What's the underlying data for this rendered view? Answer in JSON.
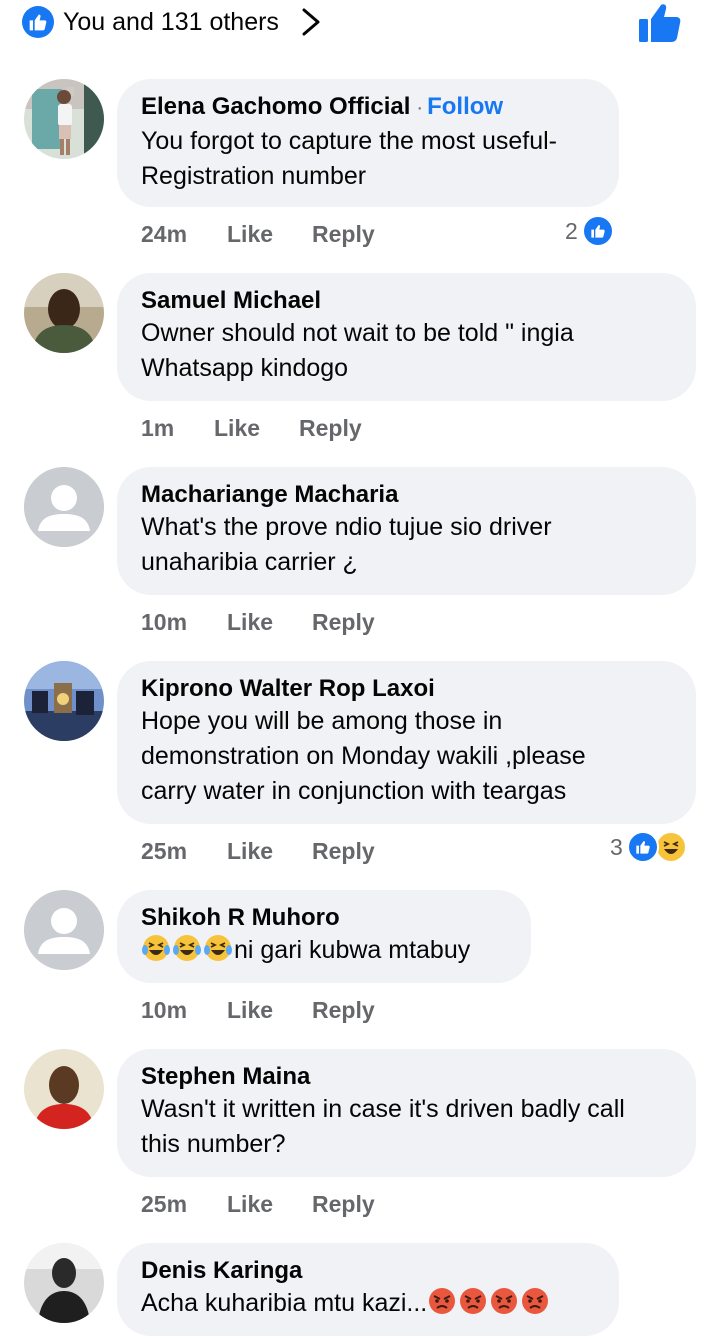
{
  "header": {
    "reactions_summary": "You and 131 others"
  },
  "comments": [
    {
      "name": "Elena Gachomo Official",
      "dot": "·",
      "follow": "Follow",
      "lines": [
        "You forgot to capture the most useful-",
        "Registration number"
      ],
      "time": "24m",
      "like": "Like",
      "reply": "Reply",
      "reaction_count": "2"
    },
    {
      "name": "Samuel Michael",
      "lines": [
        "Owner should not wait to be told \" ingia",
        "Whatsapp kindogo"
      ],
      "time": "1m",
      "like": "Like",
      "reply": "Reply"
    },
    {
      "name": "Machariange Macharia",
      "lines": [
        "What's the prove ndio tujue sio driver",
        "unaharibia carrier ¿"
      ],
      "time": "10m",
      "like": "Like",
      "reply": "Reply"
    },
    {
      "name": "Kiprono Walter Rop Laxoi",
      "lines": [
        "Hope you will be among those in",
        "demonstration on Monday wakili ,please",
        "carry water in conjunction with teargas"
      ],
      "time": "25m",
      "like": "Like",
      "reply": "Reply",
      "reaction_count": "3"
    },
    {
      "name": "Shikoh R Muhoro",
      "lines": [
        "ni gari kubwa mtabuy"
      ],
      "time": "10m",
      "like": "Like",
      "reply": "Reply"
    },
    {
      "name": "Stephen Maina",
      "lines": [
        "Wasn't it written in case it's driven badly call",
        "this number?"
      ],
      "time": "25m",
      "like": "Like",
      "reply": "Reply"
    },
    {
      "name": "Denis Karinga",
      "lines": [
        "Acha kuharibia mtu kazi..."
      ]
    }
  ],
  "icons": {
    "like_reaction": "thumbs-up-icon",
    "haha_reaction": "laughing-face-icon",
    "angry_emoji": "angry-face-icon",
    "crying_laughing_emoji": "tears-of-joy-icon"
  },
  "colors": {
    "accent": "#1877f2",
    "bubble": "#f0f2f5",
    "meta": "#65676b"
  }
}
